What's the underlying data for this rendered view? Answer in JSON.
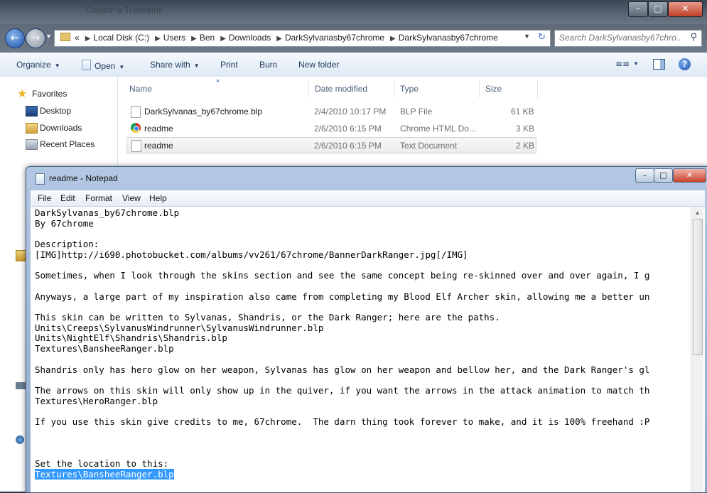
{
  "explorer": {
    "title": "Creator is Tremorine",
    "address": {
      "crumbs": [
        "Local Disk (C:)",
        "Users",
        "Ben",
        "Downloads",
        "DarkSylvanasby67chrome",
        "DarkSylvanasby67chrome"
      ],
      "lead": "«"
    },
    "search": {
      "placeholder": "Search DarkSylvanasby67chro..."
    },
    "toolbar": {
      "organize": "Organize",
      "open": "Open",
      "share": "Share with",
      "print": "Print",
      "burn": "Burn",
      "new_folder": "New folder"
    },
    "nav": {
      "favorites": "Favorites",
      "desktop": "Desktop",
      "downloads": "Downloads",
      "recent": "Recent Places"
    },
    "columns": {
      "name": "Name",
      "date": "Date modified",
      "type": "Type",
      "size": "Size"
    },
    "files": [
      {
        "name": "DarkSylvanas_by67chrome.blp",
        "date": "2/4/2010 10:17 PM",
        "type": "BLP File",
        "size": "61 KB",
        "icon": "document-icon"
      },
      {
        "name": "readme",
        "date": "2/6/2010 6:15 PM",
        "type": "Chrome HTML Do...",
        "size": "3 KB",
        "icon": "chrome-icon"
      },
      {
        "name": "readme",
        "date": "2/6/2010 6:15 PM",
        "type": "Text Document",
        "size": "2 KB",
        "icon": "text-document-icon"
      }
    ]
  },
  "notepad": {
    "title": "readme - Notepad",
    "menu": {
      "file": "File",
      "edit": "Edit",
      "format": "Format",
      "view": "View",
      "help": "Help"
    },
    "lines": [
      "DarkSylvanas_by67chrome.blp",
      "By 67chrome",
      "",
      "Description:",
      "[IMG]http://i690.photobucket.com/albums/vv261/67chrome/BannerDarkRanger.jpg[/IMG]",
      "",
      "Sometimes, when I look through the skins section and see the same concept being re-skinned over and over again, I g",
      "",
      "Anyways, a large part of my inspiration also came from completing my Blood Elf Archer skin, allowing me a better un",
      "",
      "This skin can be written to Sylvanas, Shandris, or the Dark Ranger; here are the paths.",
      "Units\\Creeps\\SylvanusWindrunner\\SylvanusWindrunner.blp",
      "Units\\NightElf\\Shandris\\Shandris.blp",
      "Textures\\BansheeRanger.blp",
      "",
      "Shandris only has hero glow on her weapon, Sylvanas has glow on her weapon and bellow her, and the Dark Ranger's gl",
      "",
      "The arrows on this skin will only show up in the quiver, if you want the arrows in the attack animation to match th",
      "Textures\\HeroRanger.blp",
      "",
      "If you use this skin give credits to me, 67chrome.  The darn thing took forever to make, and it is 100% freehand :P",
      "",
      "",
      "",
      "Set the location to this:"
    ],
    "selected_line": "Textures\\BansheeRanger.blp"
  },
  "colors": {
    "selection": "#3399ff",
    "toolbar_text": "#1e395b",
    "accent": "#1c4fa8"
  }
}
